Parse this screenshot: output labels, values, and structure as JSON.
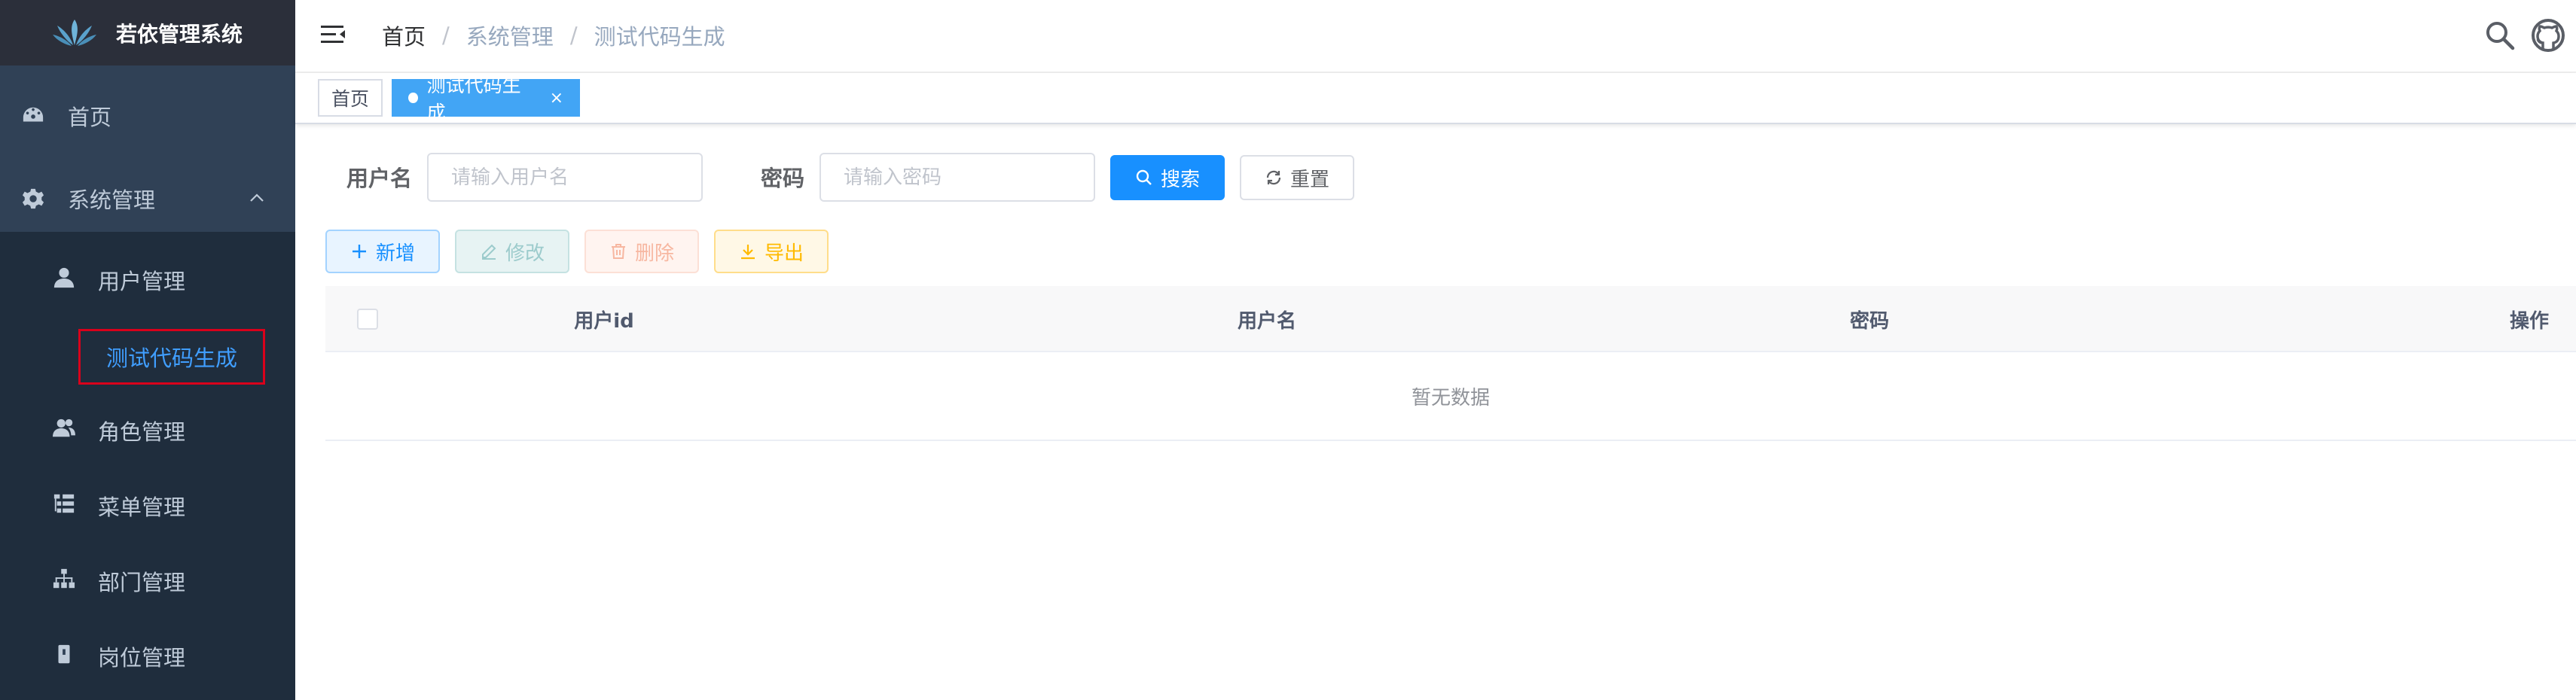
{
  "app": {
    "title": "若依管理系统"
  },
  "sidebar": {
    "home_label": "首页",
    "system_label": "系统管理",
    "sub_items": [
      {
        "label": "用户管理",
        "icon": "user-icon"
      },
      {
        "label": "测试代码生成",
        "icon": "",
        "active": true
      },
      {
        "label": "角色管理",
        "icon": "peoples-icon"
      },
      {
        "label": "菜单管理",
        "icon": "tree-table-icon"
      },
      {
        "label": "部门管理",
        "icon": "tree-icon"
      },
      {
        "label": "岗位管理",
        "icon": "post-icon"
      }
    ],
    "colors": {
      "bg": "#304156",
      "sub_bg": "#1f2d3d",
      "active_text": "#409eff",
      "highlight_border": "#d9001b"
    }
  },
  "breadcrumb": {
    "home": "首页",
    "parent": "系统管理",
    "current": "测试代码生成",
    "separator": "/"
  },
  "tags": {
    "home": "首页",
    "active": "测试代码生成",
    "close": "×"
  },
  "search": {
    "username_label": "用户名",
    "username_placeholder": "请输入用户名",
    "password_label": "密码",
    "password_placeholder": "请输入密码",
    "search_button": "搜索",
    "reset_button": "重置"
  },
  "toolbar": {
    "add": "新增",
    "edit": "修改",
    "delete": "删除",
    "export": "导出"
  },
  "table": {
    "columns": [
      "用户id",
      "用户名",
      "密码",
      "操作"
    ],
    "empty_text": "暂无数据"
  },
  "accent": "#1890ff"
}
